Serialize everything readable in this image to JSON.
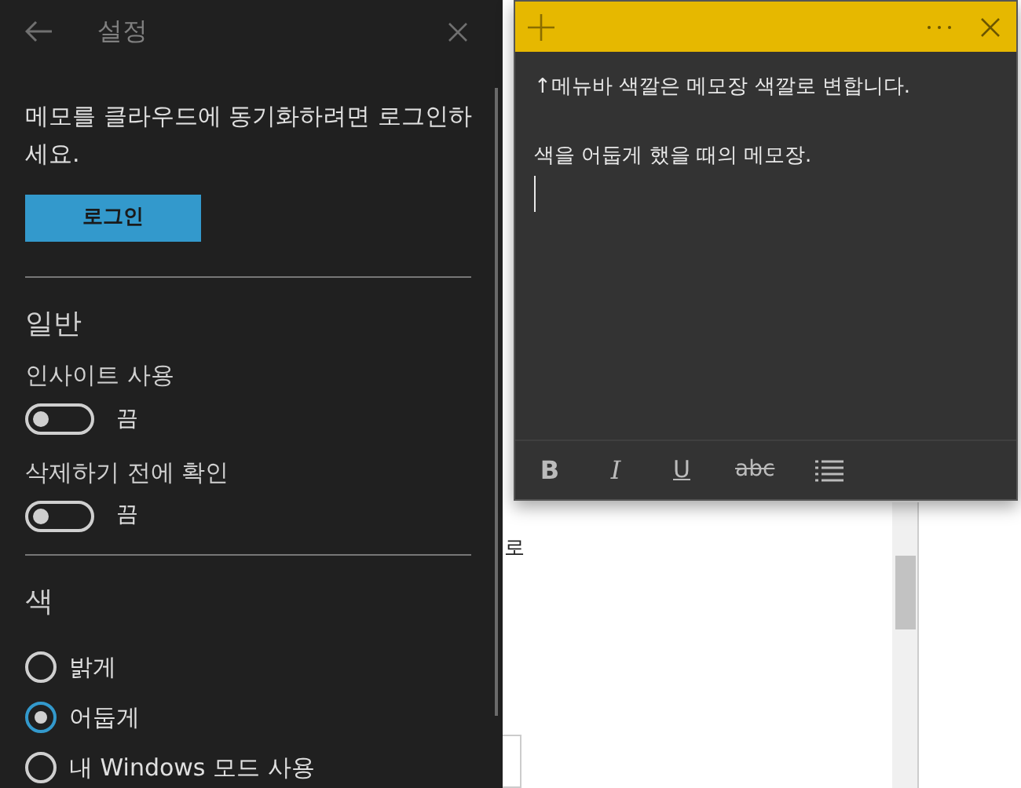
{
  "settings": {
    "title": "설정",
    "sync_message": "메모를 클라우드에 동기화하려면 로그인하세요.",
    "login_button": "로그인",
    "general": {
      "heading": "일반",
      "toggles": [
        {
          "label": "인사이트 사용",
          "on": false,
          "state_text": "끔"
        },
        {
          "label": "삭제하기 전에 확인",
          "on": false,
          "state_text": "끔"
        }
      ]
    },
    "color": {
      "heading": "색",
      "options": [
        {
          "label": "밝게",
          "selected": false
        },
        {
          "label": "어둡게",
          "selected": true
        },
        {
          "label": "내 Windows 모드 사용",
          "selected": false
        }
      ]
    }
  },
  "background": {
    "text_fragment": "로"
  },
  "note": {
    "paragraphs": [
      "↑메뉴바 색깔은 메모장 색깔로 변합니다.",
      "색을 어둡게 했을 때의 메모장."
    ],
    "toolbar": [
      {
        "kind": "bold",
        "label": "B"
      },
      {
        "kind": "italic",
        "label": "I"
      },
      {
        "kind": "underline",
        "label": "U"
      },
      {
        "kind": "strike",
        "label": "abc"
      },
      {
        "kind": "list"
      }
    ]
  }
}
